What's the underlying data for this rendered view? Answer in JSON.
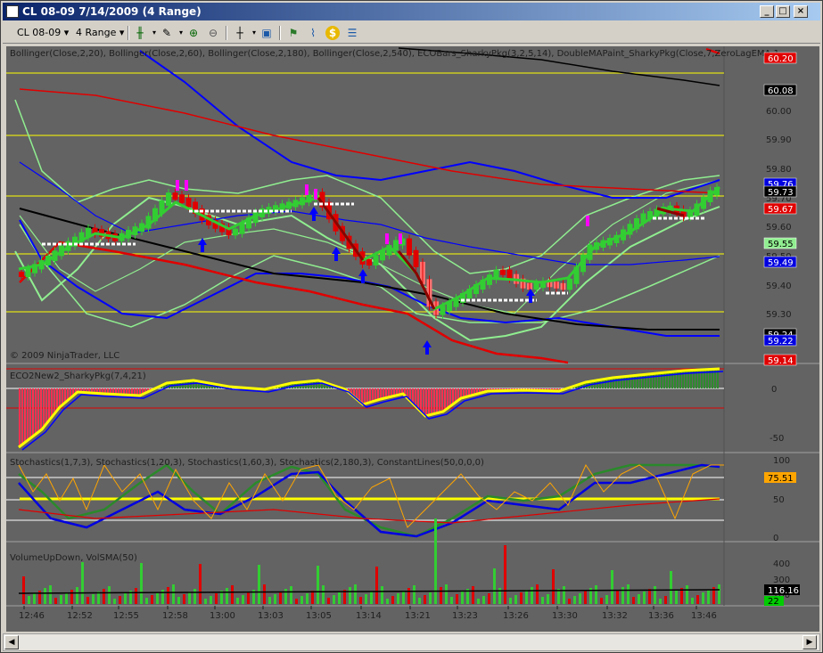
{
  "window": {
    "title": "CL 08-09  7/14/2009 (4 Range)",
    "buttons": [
      "_",
      "□",
      "×"
    ]
  },
  "toolbar": {
    "instrument": "CL 08-09",
    "period": "4 Range",
    "icons": [
      "candlestick-icon",
      "pencil-icon",
      "zoom-in-icon",
      "zoom-out-icon",
      "crosshair-icon",
      "properties-icon",
      "strategy-icon",
      "indicator-icon",
      "dollar-icon",
      "data-box-icon"
    ]
  },
  "panels": {
    "price": {
      "label": "Bollinger(Close,2,20), Bollinger(Close,2,60), Bollinger(Close,2,180), Bollinger(Close,2,540), ECOBars_SharkyPkg(3,2,5,14), DoubleMAPaint_SharkyPkg(Close,7,ZeroLagEMA,1",
      "copyright": "© 2009 NinjaTrader, LLC",
      "axis_ticks": [
        "59.80",
        "59.70",
        "59.60",
        "59.50",
        "59.40",
        "59.30",
        "60.00",
        "59.90"
      ],
      "badges": [
        {
          "text": "60.20",
          "bg": "#e00000",
          "fg": "#ffffff"
        },
        {
          "text": "60.08",
          "bg": "#000000",
          "fg": "#ffffff"
        },
        {
          "text": "59.76",
          "bg": "#0000e0",
          "fg": "#ffffff"
        },
        {
          "text": "59.73",
          "bg": "#000000",
          "fg": "#ffffff"
        },
        {
          "text": "59.67",
          "bg": "#e00000",
          "fg": "#ffffff"
        },
        {
          "text": "59.55",
          "bg": "#90ee90",
          "fg": "#000000"
        },
        {
          "text": "59.49",
          "bg": "#0000e0",
          "fg": "#ffffff"
        },
        {
          "text": "59.24",
          "bg": "#000000",
          "fg": "#ffffff"
        },
        {
          "text": "59.22",
          "bg": "#0000e0",
          "fg": "#ffffff"
        },
        {
          "text": "59.14",
          "bg": "#e00000",
          "fg": "#ffffff"
        }
      ]
    },
    "eco": {
      "label": "ECO2New2_SharkyPkg(7,4,21)",
      "axis_ticks": [
        "0",
        "-50"
      ]
    },
    "stoch": {
      "label": "Stochastics(1,7,3), Stochastics(1,20,3), Stochastics(1,60,3), Stochastics(2,180,3), ConstantLines(50,0,0,0)",
      "axis_ticks": [
        "100",
        "50",
        "0"
      ],
      "badge": {
        "text": "75.51",
        "bg": "#ffa500",
        "fg": "#000000"
      }
    },
    "volume": {
      "label": "VolumeUpDown, VolSMA(50)",
      "axis_ticks": [
        "400",
        "300",
        "200"
      ],
      "badges": [
        {
          "text": "116.16",
          "bg": "#000000",
          "fg": "#ffffff"
        },
        {
          "text": "22",
          "bg": "#00cc00",
          "fg": "#000000"
        }
      ]
    }
  },
  "time_axis": [
    "12:46",
    "12:52",
    "12:55",
    "12:58",
    "13:00",
    "13:03",
    "13:05",
    "13:14",
    "13:21",
    "13:23",
    "13:26",
    "13:30",
    "13:32",
    "13:36",
    "13:46"
  ],
  "colors": {
    "background": "#636363",
    "bollinger_fast": "#90ee90",
    "bollinger_mid": "#0000ff",
    "bollinger_slow": "#e00000",
    "bollinger_long": "#000000",
    "up_bar": "#32cd32",
    "down_bar": "#e00000",
    "constant_line": "#ffff00"
  }
}
